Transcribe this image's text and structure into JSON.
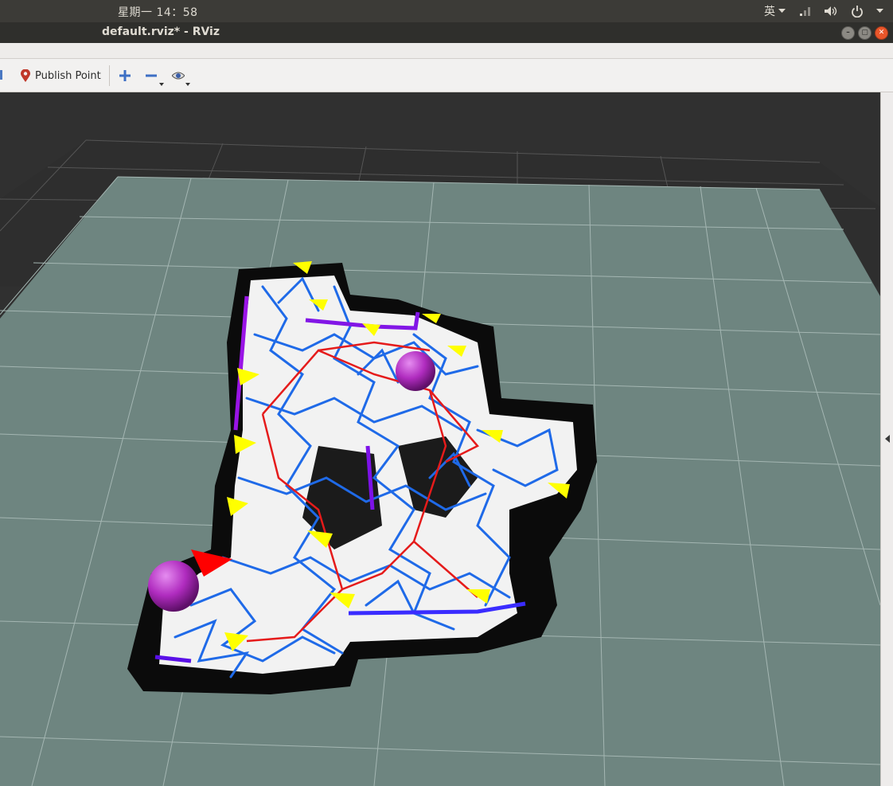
{
  "system_bar": {
    "clock": "星期一 14：58",
    "input_method": "英"
  },
  "window": {
    "title": "default.rviz* - RViz"
  },
  "toolbar": {
    "publish_point_label": "Publish Point"
  },
  "colors": {
    "grid_plane": "#6e8580",
    "grid_lines": "#9fb2ae",
    "map_wall": "#0c0c0c",
    "map_free": "#f2f2f2",
    "rrt_tree": "#1f6ae8",
    "path": "#e51b1b",
    "frontier_marker": "#ffff00",
    "robot_sphere": "#b02cbf",
    "goal_marker": "#ff0000"
  }
}
